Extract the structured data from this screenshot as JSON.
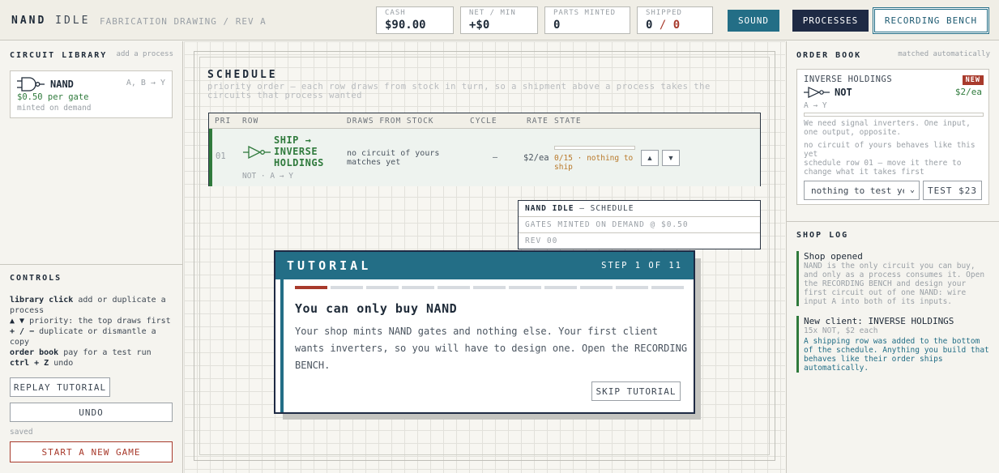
{
  "header": {
    "brand_main": "NAND",
    "brand_idle": "IDLE",
    "subtitle": "FABRICATION DRAWING / REV A",
    "cash_label": "CASH",
    "cash_value": "$90.00",
    "net_label": "NET / MIN",
    "net_value": "+$0",
    "parts_label": "PARTS MINTED",
    "parts_value": "0",
    "shipped_label": "SHIPPED",
    "shipped_value": "0",
    "shipped_sep": "/",
    "shipped_failed": "0",
    "sound_label": "SOUND",
    "processes_label": "PROCESSES",
    "bench_label": "RECORDING BENCH"
  },
  "library": {
    "title": "CIRCUIT LIBRARY",
    "hint": "add a process",
    "card": {
      "name": "NAND",
      "io": "A, B → Y",
      "price": "$0.50 per gate",
      "note": "minted on demand"
    }
  },
  "controls": {
    "title": "CONTROLS",
    "lines": [
      {
        "key": "library click",
        "text": "add or duplicate a process"
      },
      {
        "key": "▲ ▼",
        "text": "priority: the top draws first"
      },
      {
        "key": "+ / −",
        "text": "duplicate or dismantle a copy"
      },
      {
        "key": "order book",
        "text": "pay for a test run"
      },
      {
        "key": "ctrl + Z",
        "text": "undo"
      }
    ],
    "replay_label": "REPLAY TUTORIAL",
    "undo_label": "UNDO",
    "saved_label": "saved",
    "new_game_label": "START A NEW GAME"
  },
  "schedule": {
    "title": "SCHEDULE",
    "desc": "priority order — each row draws from stock in turn, so a shipment above a process takes the circuits that process wanted",
    "columns": [
      "PRI",
      "ROW",
      "DRAWS FROM STOCK",
      "CYCLE",
      "RATE",
      "STATE"
    ],
    "row": {
      "pri": "01",
      "name": "SHIP → INVERSE HOLDINGS",
      "sub": "NOT · A → Y",
      "draws": "no circuit of yours matches yet",
      "cycle": "—",
      "rate": "$2/ea",
      "progress": 0,
      "state_count": "0/15",
      "state_text": "· nothing to ship",
      "up": "▲",
      "down": "▼"
    }
  },
  "stamp": {
    "line1_a": "NAND IDLE",
    "line1_b": "— SCHEDULE",
    "line2": "GATES MINTED ON DEMAND @ $0.50",
    "line3": "REV 00"
  },
  "tutorial": {
    "title": "TUTORIAL",
    "step": "STEP 1 OF 11",
    "total_steps": 11,
    "current_step": 1,
    "heading": "You can only buy NAND",
    "body": "Your shop mints NAND gates and nothing else. Your first client wants inverters, so you will have to design one. Open the RECORDING BENCH.",
    "skip_label": "SKIP TUTORIAL"
  },
  "orders": {
    "title": "ORDER BOOK",
    "hint": "matched automatically",
    "client": "INVERSE HOLDINGS",
    "badge": "NEW",
    "circuit": "NOT",
    "price": "$2/ea",
    "io": "A → Y",
    "progress": 0,
    "desc": "We need signal inverters. One input, one output, opposite.",
    "status1": "no circuit of yours behaves like this yet",
    "status2": "schedule row 01 — move it there to change what it takes first",
    "select_value": "nothing to test yet",
    "test_label": "TEST $23"
  },
  "shoplog": {
    "title": "SHOP LOG",
    "items": [
      {
        "head": "Shop opened",
        "text": "NAND is the only circuit you can buy, and only as a process consumes it. Open the RECORDING BENCH and design your first circuit out of one NAND: wire input A into both of its inputs."
      },
      {
        "head": "New client: INVERSE HOLDINGS",
        "sub": "15x NOT, $2 each",
        "text": "A shipping row was added to the bottom of the schedule. Anything you build that behaves like their order ships automatically."
      }
    ]
  },
  "colors": {
    "accent": "#236e86",
    "navy": "#1e2a44",
    "green": "#2f7a3c",
    "red": "#a83a2c"
  }
}
